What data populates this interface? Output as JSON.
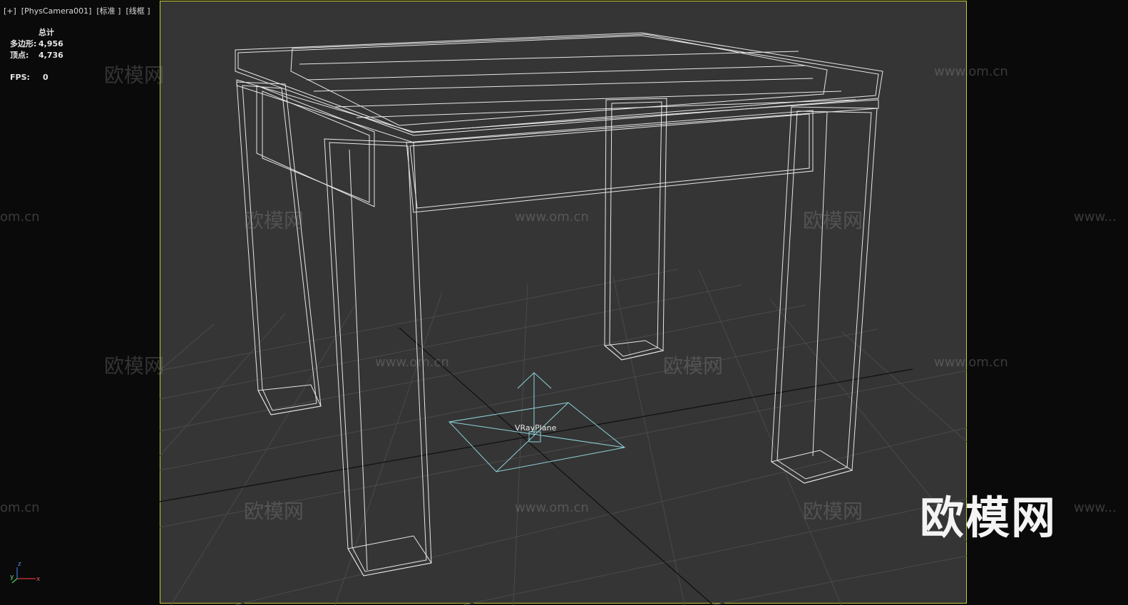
{
  "viewport": {
    "label": "[+]  [PhysCamera001]  [标准 ]  [线框 ]",
    "frame_color": "#c8c83a",
    "background": "#353535"
  },
  "stats": {
    "header": "总计",
    "polys_label": "多边形:",
    "polys_value": "4,956",
    "verts_label": "顶点:",
    "verts_value": "4,736",
    "fps_label": "FPS:",
    "fps_value": "0"
  },
  "scene": {
    "object_label": "VRayPlane",
    "wire_color": "#e8e8e8",
    "light_color": "#8fd3da"
  },
  "watermarks": {
    "cn": "欧模网",
    "url": "www.om.cn",
    "url_partial": "om.cn",
    "url_cut": "www..."
  },
  "brand": {
    "logo_text": "欧模网"
  },
  "axis_gizmo": {
    "z": "z",
    "x": "x",
    "y": "y"
  }
}
